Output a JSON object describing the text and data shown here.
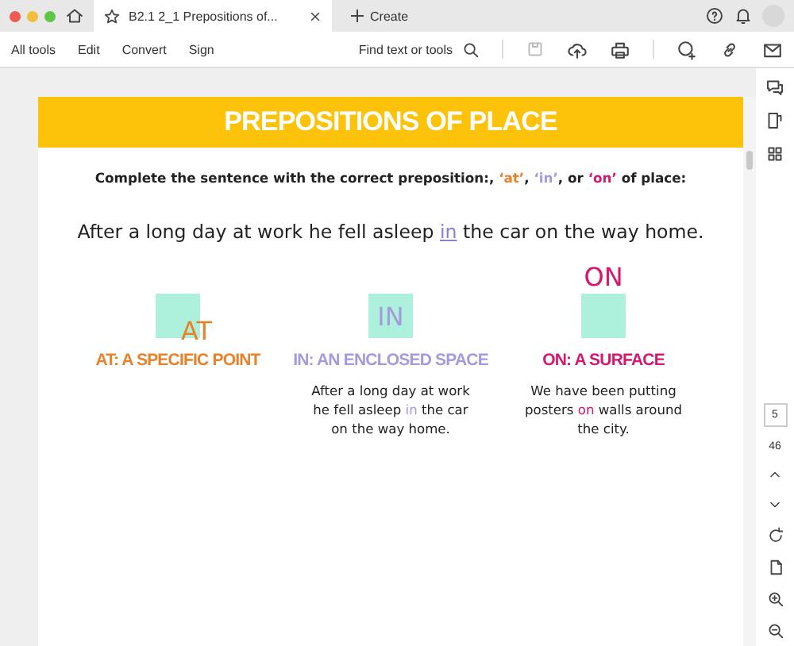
{
  "window": {
    "tab_title": "B2.1 2_1 Prepositions of...",
    "new_tab": "Create"
  },
  "toolbar": {
    "menus": [
      "All tools",
      "Edit",
      "Convert",
      "Sign"
    ],
    "search": "Find text or tools"
  },
  "slide": {
    "title": "PREPOSITIONS OF PLACE",
    "instruction": [
      {
        "text": "Complete the sentence with the correct preposition:, "
      },
      {
        "text": "‘at’",
        "color": "#e8822a"
      },
      {
        "text": ", "
      },
      {
        "text": "‘in’",
        "color": "#a49bdc"
      },
      {
        "text": ", or "
      },
      {
        "text": "‘on’",
        "color": "#d6176e"
      },
      {
        "text": " of place:"
      }
    ],
    "sentence": [
      {
        "text": "After a long day at work he fell asleep "
      },
      {
        "text": "in",
        "kind": "answer",
        "color": "#8a7fd0"
      },
      {
        "text": " the car on the way home."
      }
    ],
    "columns": [
      {
        "word": "AT",
        "kind": "corner",
        "heading": "AT: A SPECIFIC POINT",
        "color": "#e8822a"
      },
      {
        "word": "IN",
        "kind": "inside",
        "heading": "IN: AN ENCLOSED SPACE",
        "color": "#a49bdc",
        "example": [
          {
            "text": "After a long day at work he fell asleep "
          },
          {
            "text": "in",
            "color": "#a49bdc"
          },
          {
            "text": " the car on the way home."
          }
        ]
      },
      {
        "word": "ON",
        "kind": "above",
        "heading": "ON: A SURFACE",
        "color": "#d6176e",
        "example": [
          {
            "text": "We have been putting posters "
          },
          {
            "text": "on",
            "color": "#d6176e"
          },
          {
            "text": " walls around the city."
          }
        ]
      }
    ]
  },
  "navigation": {
    "page": "5",
    "total": "46"
  }
}
